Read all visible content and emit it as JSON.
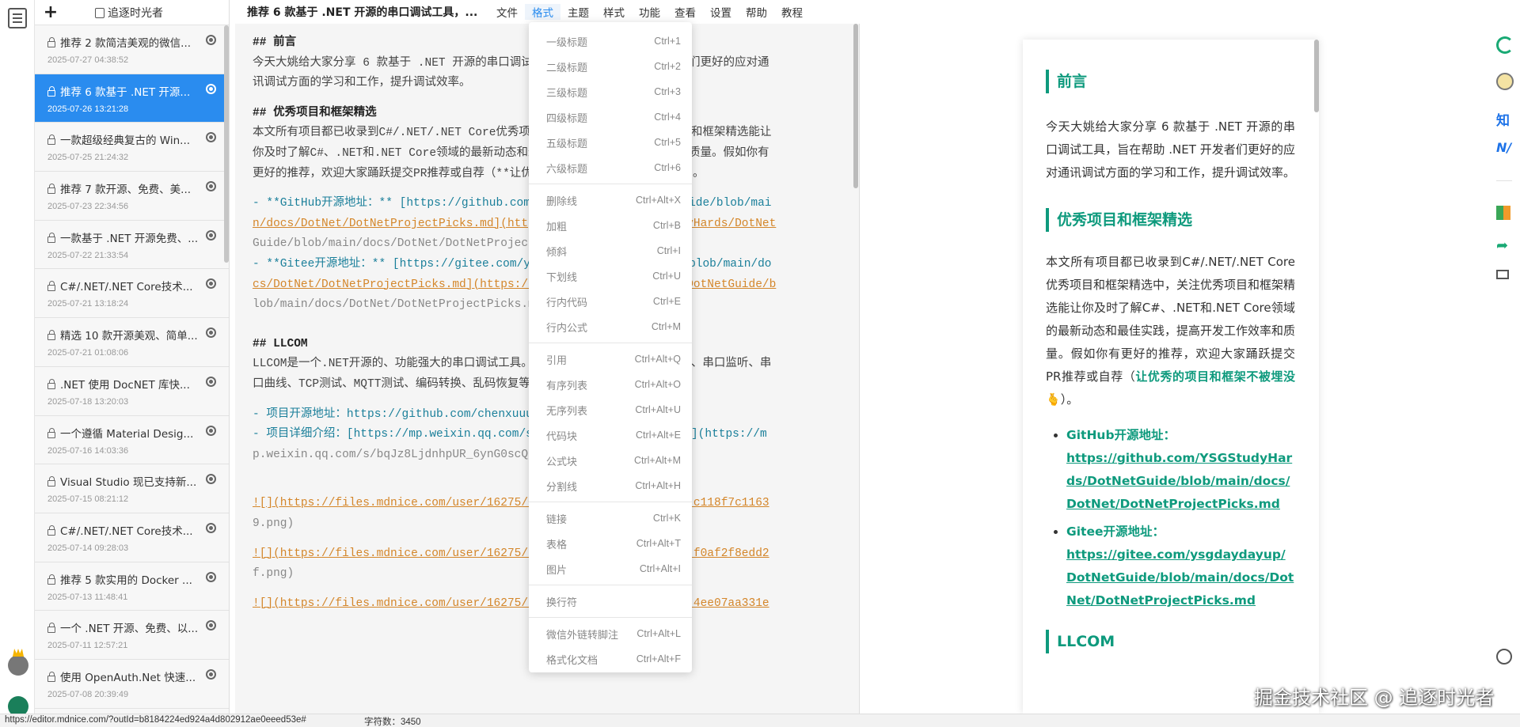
{
  "sidebar": {
    "add_label": "+",
    "username": "追逐时光者",
    "articles": [
      {
        "title": "推荐 2 款简洁美观的微信...",
        "date": "2025-07-27 04:38:52",
        "active": false
      },
      {
        "title": "推荐 6 款基于 .NET 开源...",
        "date": "2025-07-26 13:21:28",
        "active": true
      },
      {
        "title": "一款超级经典复古的 Win...",
        "date": "2025-07-25 21:24:32",
        "active": false
      },
      {
        "title": "推荐 7 款开源、免费、美...",
        "date": "2025-07-23 22:34:56",
        "active": false
      },
      {
        "title": "一款基于 .NET 开源免费、...",
        "date": "2025-07-22 21:33:54",
        "active": false
      },
      {
        "title": "C#/.NET/.NET Core技术...",
        "date": "2025-07-21 13:18:24",
        "active": false
      },
      {
        "title": "精选 10 款开源美观、简单...",
        "date": "2025-07-21 01:08:06",
        "active": false
      },
      {
        "title": ".NET 使用 DocNET 库快...",
        "date": "2025-07-18 13:20:03",
        "active": false
      },
      {
        "title": "一个遵循 Material Desig...",
        "date": "2025-07-16 14:03:36",
        "active": false
      },
      {
        "title": "Visual Studio 现已支持新...",
        "date": "2025-07-15 08:21:12",
        "active": false
      },
      {
        "title": "C#/.NET/.NET Core技术...",
        "date": "2025-07-14 09:28:03",
        "active": false
      },
      {
        "title": "推荐 5 款实用的 Docker ...",
        "date": "2025-07-13 11:48:41",
        "active": false
      },
      {
        "title": "一个 .NET 开源、免费、以...",
        "date": "2025-07-11 12:57:21",
        "active": false
      },
      {
        "title": "使用 OpenAuth.Net 快速...",
        "date": "2025-07-08 20:39:49",
        "active": false
      }
    ]
  },
  "topbar": {
    "title": "推荐 6 款基于 .NET 开源的串口调试工具，...",
    "menu": [
      "文件",
      "格式",
      "主题",
      "样式",
      "功能",
      "查看",
      "设置",
      "帮助",
      "教程"
    ]
  },
  "editor": {
    "lines": [
      {
        "text": "## 前言",
        "cls": "h"
      },
      {
        "text": "今天大姚给大家分享 6 款基于 .NET 开源的串口调试工具，旨在帮助 .NET 开发者们更好的应对通",
        "cls": ""
      },
      {
        "text": "讯调试方面的学习和工作，提升调试效率。",
        "cls": ""
      },
      {
        "text": "",
        "cls": ""
      },
      {
        "text": "## 优秀项目和框架精选",
        "cls": "h"
      },
      {
        "text": "本文所有项目都已收录到C#/.NET/.NET Core优秀项目和框架精选中，关注优秀项目和框架精选能让",
        "cls": ""
      },
      {
        "text": "你及时了解C#、.NET和.NET Core领域的最新动态和最佳实践，提高开发工作效率和质量。假如你有",
        "cls": ""
      },
      {
        "text": "更好的推荐，欢迎大家踊跃提交PR推荐或自荐（**让优秀的项目和框架不被埋没**🫰）。",
        "cls": ""
      },
      {
        "text": "",
        "cls": ""
      },
      {
        "text": "- **GitHub开源地址：** [https://github.com/YSGStudyHards/DotNetGuide/blob/mai",
        "cls": "dash"
      },
      {
        "text": "n/docs/DotNet/DotNetProjectPicks.md](https://github.com/YSGStudyHards/DotNet",
        "cls": "link"
      },
      {
        "text": "Guide/blob/main/docs/DotNet/DotNetProjectPicks.md)",
        "cls": "url"
      },
      {
        "text": "- **Gitee开源地址：** [https://gitee.com/ysgdaydayup/DotNetGuide/blob/main/do",
        "cls": "dash"
      },
      {
        "text": "cs/DotNet/DotNetProjectPicks.md](https://gitee.com/ysgdaydayup/DotNetGuide/b",
        "cls": "link"
      },
      {
        "text": "lob/main/docs/DotNet/DotNetProjectPicks.md)",
        "cls": "url"
      },
      {
        "text": "",
        "cls": ""
      },
      {
        "text": "",
        "cls": ""
      },
      {
        "text": "## LLCOM",
        "cls": "h"
      },
      {
        "text": "LLCOM是一个.NET开源的、功能强大的串口调试工具。支持Lua自动化处理、串口调试、串口监听、串",
        "cls": ""
      },
      {
        "text": "口曲线、TCP测试、MQTT测试、编码转换、乱码恢复等功能。",
        "cls": ""
      },
      {
        "text": "",
        "cls": ""
      },
      {
        "text": "- 项目开源地址：https://github.com/chenxuuu/llcom",
        "cls": "dash"
      },
      {
        "text": "- 项目详细介绍：[https://mp.weixin.qq.com/s/bqJz8LjdnhpUR_6ynG0scQ](https://m",
        "cls": "dash"
      },
      {
        "text": "p.weixin.qq.com/s/bqJz8LjdnhpUR_6ynG0scQ)",
        "cls": "url"
      },
      {
        "text": "",
        "cls": ""
      },
      {
        "text": "",
        "cls": ""
      },
      {
        "text": "",
        "cls": ""
      },
      {
        "text": "![](https://files.mdnice.com/user/16275/0f1c3d5e-4d2a-4c5f-9783-c118f7c1163",
        "cls": "link"
      },
      {
        "text": "9.png)",
        "cls": "url"
      },
      {
        "text": "",
        "cls": ""
      },
      {
        "text": "![](https://files.mdnice.com/user/16275/9a4b1d8e-5c3e-4b7a-b123-f0af2f8edd2",
        "cls": "link"
      },
      {
        "text": "f.png)",
        "cls": "url"
      },
      {
        "text": "",
        "cls": ""
      },
      {
        "text": "![](https://files.mdnice.com/user/16275/22f524b8-f8b4-4057-824c-4ee07aa331e",
        "cls": "link"
      }
    ]
  },
  "dropdown": {
    "groups": [
      [
        {
          "label": "一级标题",
          "shortcut": "Ctrl+1"
        },
        {
          "label": "二级标题",
          "shortcut": "Ctrl+2"
        },
        {
          "label": "三级标题",
          "shortcut": "Ctrl+3"
        },
        {
          "label": "四级标题",
          "shortcut": "Ctrl+4"
        },
        {
          "label": "五级标题",
          "shortcut": "Ctrl+5"
        },
        {
          "label": "六级标题",
          "shortcut": "Ctrl+6"
        }
      ],
      [
        {
          "label": "删除线",
          "shortcut": "Ctrl+Alt+X"
        },
        {
          "label": "加粗",
          "shortcut": "Ctrl+B"
        },
        {
          "label": "倾斜",
          "shortcut": "Ctrl+I"
        },
        {
          "label": "下划线",
          "shortcut": "Ctrl+U"
        },
        {
          "label": "行内代码",
          "shortcut": "Ctrl+E"
        },
        {
          "label": "行内公式",
          "shortcut": "Ctrl+M"
        }
      ],
      [
        {
          "label": "引用",
          "shortcut": "Ctrl+Alt+Q"
        },
        {
          "label": "有序列表",
          "shortcut": "Ctrl+Alt+O"
        },
        {
          "label": "无序列表",
          "shortcut": "Ctrl+Alt+U"
        },
        {
          "label": "代码块",
          "shortcut": "Ctrl+Alt+E"
        },
        {
          "label": "公式块",
          "shortcut": "Ctrl+Alt+M"
        },
        {
          "label": "分割线",
          "shortcut": "Ctrl+Alt+H"
        }
      ],
      [
        {
          "label": "链接",
          "shortcut": "Ctrl+K"
        },
        {
          "label": "表格",
          "shortcut": "Ctrl+Alt+T"
        },
        {
          "label": "图片",
          "shortcut": "Ctrl+Alt+I"
        }
      ],
      [
        {
          "label": "换行符",
          "shortcut": ""
        }
      ],
      [
        {
          "label": "微信外链转脚注",
          "shortcut": "Ctrl+Alt+L"
        },
        {
          "label": "格式化文档",
          "shortcut": "Ctrl+Alt+F"
        }
      ]
    ]
  },
  "preview": {
    "h_intro": "前言",
    "p_intro": "今天大姚给大家分享 6 款基于 .NET 开源的串口调试工具，旨在帮助 .NET 开发者们更好的应对通讯调试方面的学习和工作，提升调试效率。",
    "h_projects": "优秀项目和框架精选",
    "p_projects": "本文所有项目都已收录到C#/.NET/.NET Core优秀项目和框架精选中，关注优秀项目和框架精选能让你及时了解C#、.NET和.NET Core领域的最新动态和最佳实践，提高开发工作效率和质量。假如你有更好的推荐，欢迎大家踊跃提交PR推荐或自荐（",
    "p_projects_hl": "让优秀的项目和框架不被埋没🫰",
    "p_projects_end": "）。",
    "li1_label": "GitHub开源地址：",
    "li1_link": "https://github.com/YSGStudyHards/DotNetGuide/blob/main/docs/DotNet/DotNetProjectPicks.md",
    "li2_label": "Gitee开源地址：",
    "li2_link": "https://gitee.com/ysgdaydayup/DotNetGuide/blob/main/docs/DotNet/DotNetProjectPicks.md",
    "h_llcom": "LLCOM"
  },
  "tools": {
    "t3": "知",
    "t4": "N/",
    "t6": "➦"
  },
  "status": {
    "url": "https://editor.mdnice.com/?outId=b8184224ed924a4d802912ae0eeed53e#",
    "word_count": "字符数：3450"
  },
  "watermark": "掘金技术社区 @ 追逐时光者",
  "colors": {
    "accent": "#2a8cef",
    "preview_green": "#0e9a7d",
    "link_orange": "#d4862a"
  }
}
